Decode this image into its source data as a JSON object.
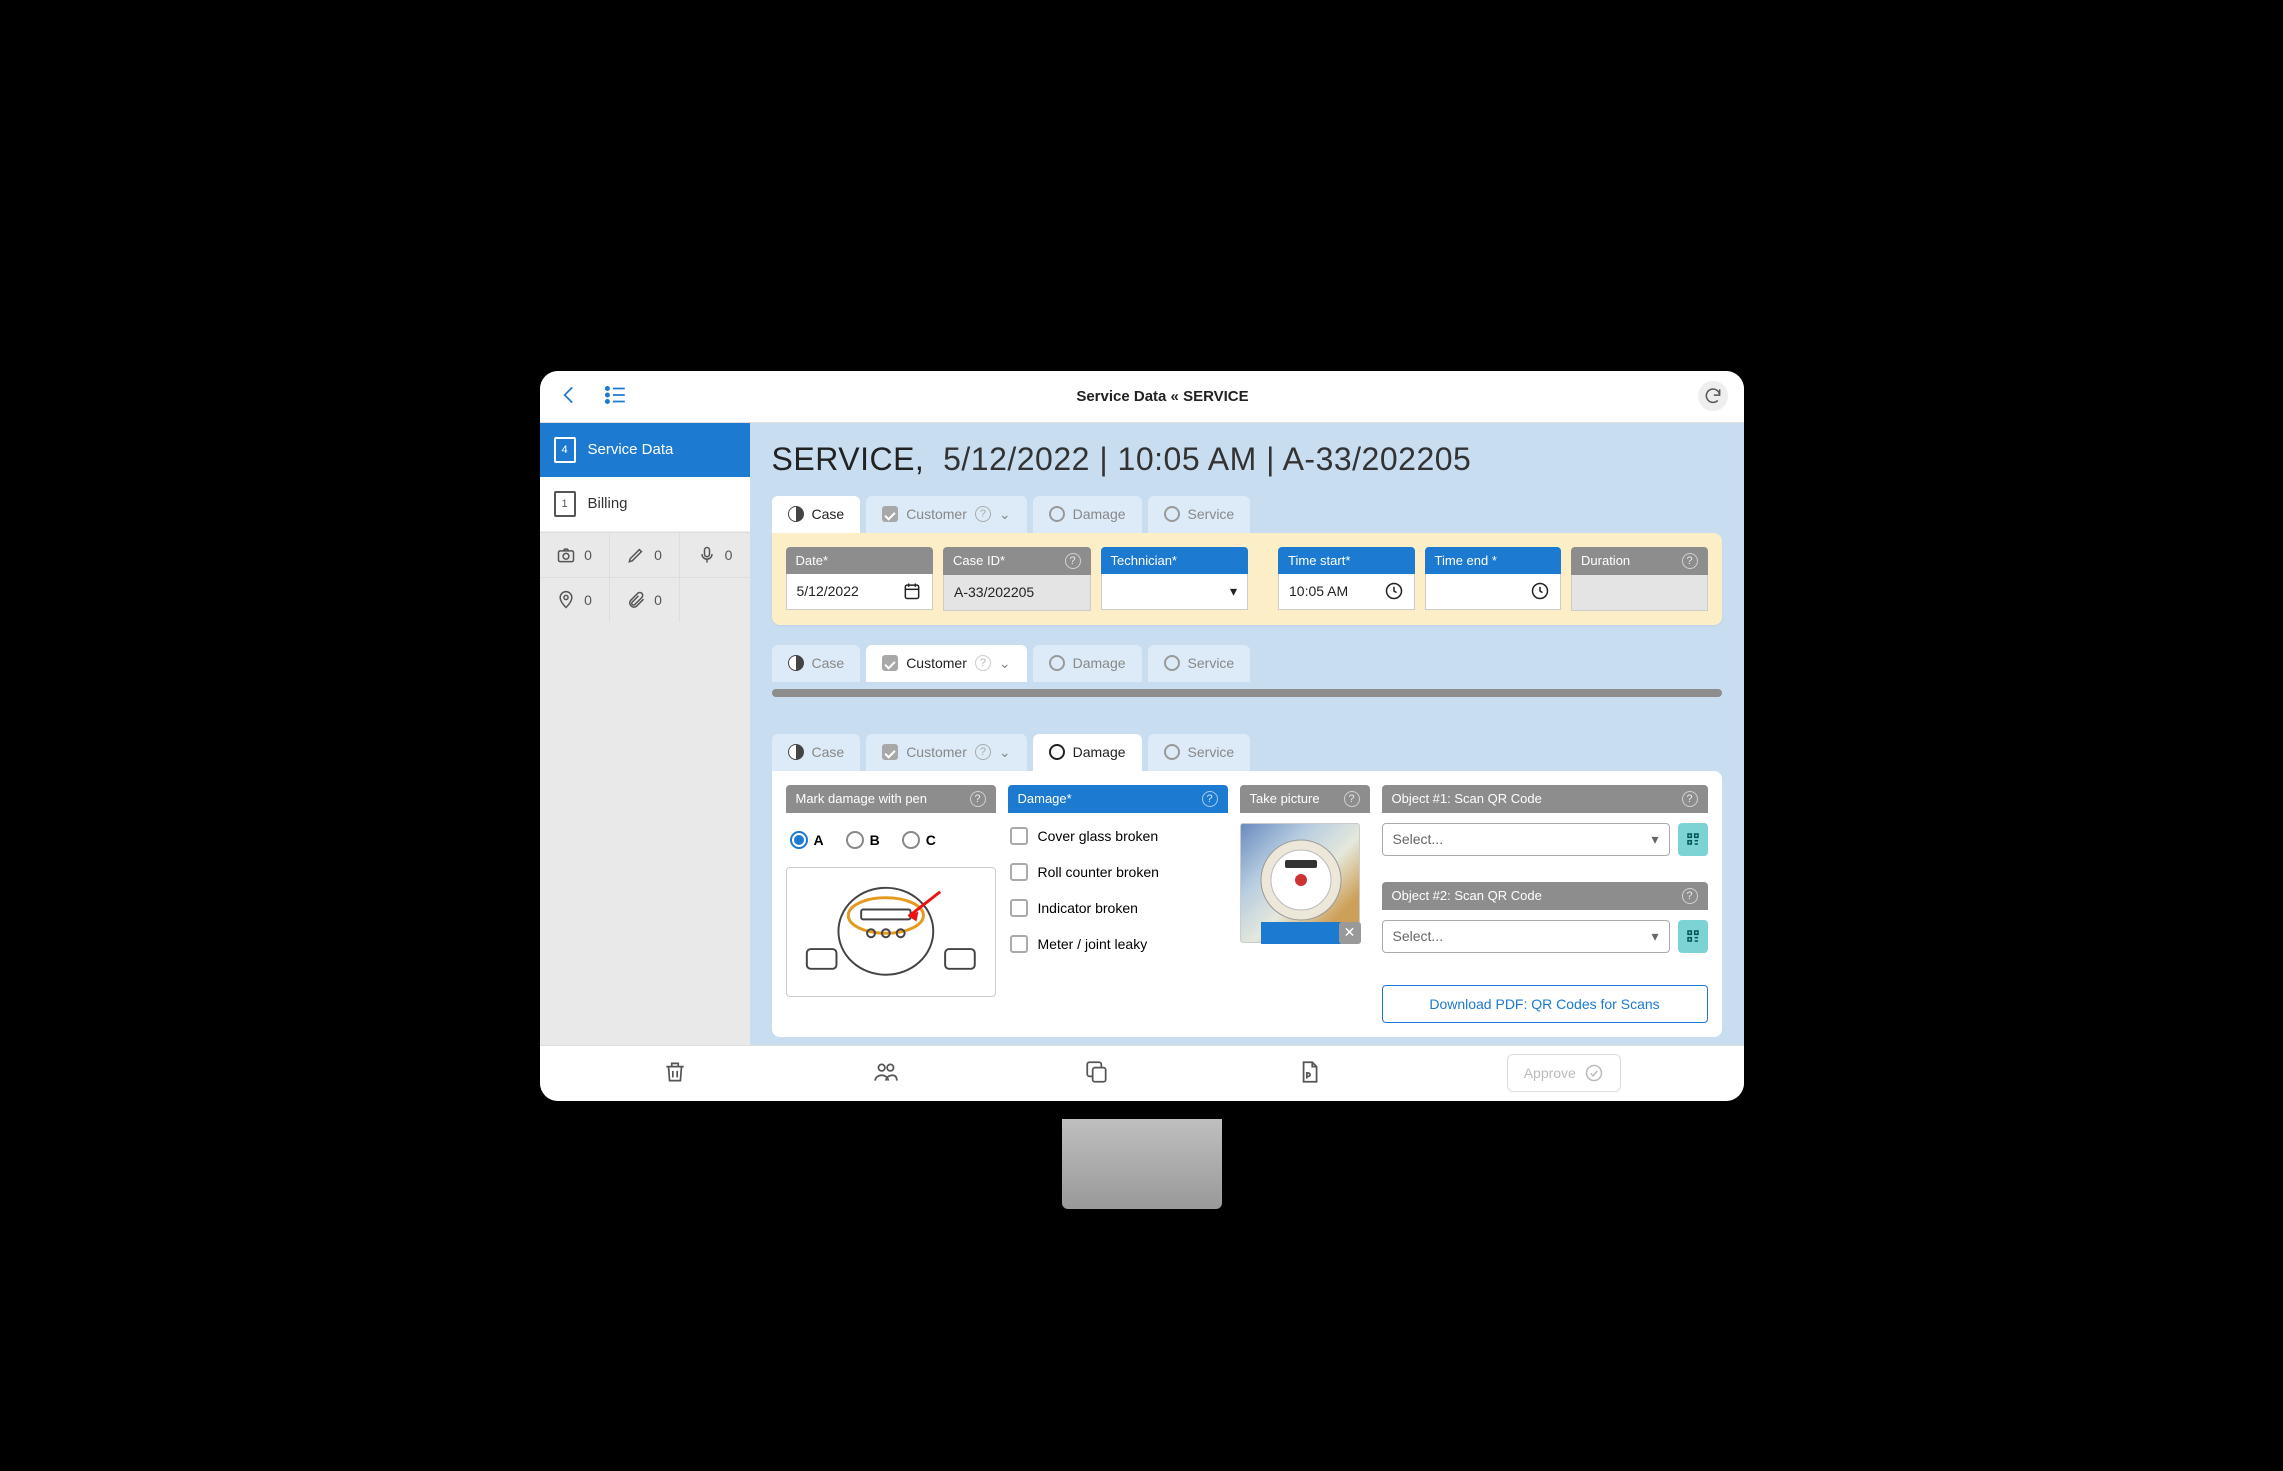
{
  "topbar": {
    "title": "Service Data « SERVICE"
  },
  "sidebar": {
    "items": [
      {
        "badge": "4",
        "label": "Service Data"
      },
      {
        "badge": "1",
        "label": "Billing"
      }
    ],
    "counters": {
      "camera": "0",
      "pen": "0",
      "mic": "0",
      "pin": "0",
      "clip": "0"
    }
  },
  "header": {
    "prefix": "SERVICE,",
    "rest": "5/12/2022 | 10:05 AM | A-33/202205"
  },
  "tabs": {
    "case": "Case",
    "customer": "Customer",
    "damage": "Damage",
    "service": "Service"
  },
  "casePanel": {
    "date_label": "Date*",
    "date_value": "5/12/2022",
    "caseid_label": "Case ID*",
    "caseid_value": "A-33/202205",
    "tech_label": "Technician*",
    "tech_value": "",
    "start_label": "Time start*",
    "start_value": "10:05 AM",
    "end_label": "Time end *",
    "end_value": "",
    "dur_label": "Duration",
    "dur_value": ""
  },
  "damagePanel": {
    "mark_label": "Mark damage with pen",
    "options": {
      "a": "A",
      "b": "B",
      "c": "C"
    },
    "damage_label": "Damage*",
    "damages": [
      "Cover glass broken",
      "Roll counter broken",
      "Indicator broken",
      "Meter / joint leaky"
    ],
    "picture_label": "Take picture",
    "qr1_label": "Object #1: Scan QR Code",
    "qr2_label": "Object #2: Scan QR Code",
    "select_placeholder": "Select...",
    "download_link": "Download PDF: QR Codes for Scans"
  },
  "bottom": {
    "approve": "Approve"
  }
}
